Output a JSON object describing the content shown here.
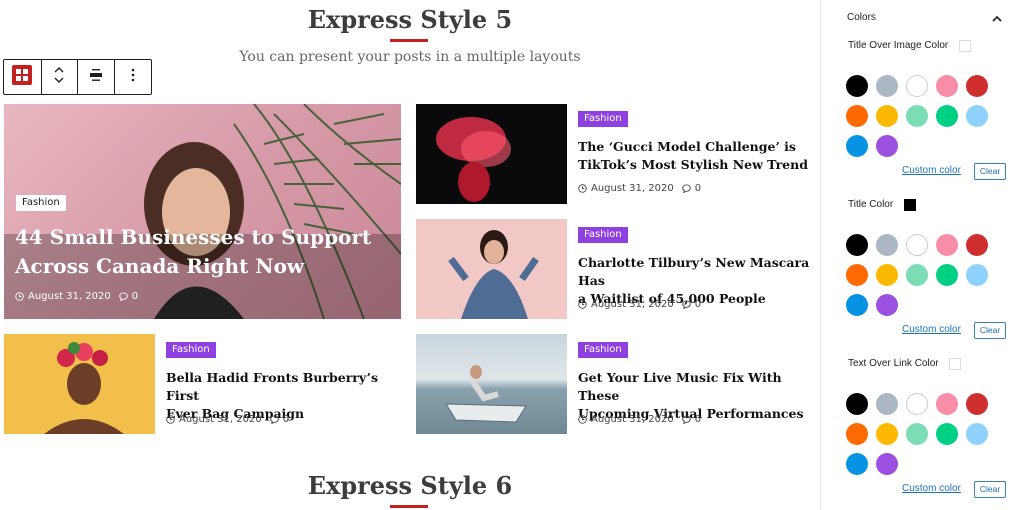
{
  "sections": {
    "style5_title": "Express Style 5",
    "style5_subtitle": "You can present your posts in a multiple layouts",
    "style6_title": "Express Style 6"
  },
  "toolbar": {
    "icons": [
      "block-layout-icon",
      "move-arrows-icon",
      "align-icon",
      "more-options-icon"
    ]
  },
  "featured_post": {
    "category": "Fashion",
    "title_line1": "44 Small Businesses to Support",
    "title_line2": "Across Canada Right Now",
    "date": "August 31, 2020",
    "comments": "0"
  },
  "posts": [
    {
      "category": "Fashion",
      "title_line1": "The ‘Gucci Model Challenge’ is",
      "title_line2": "TikTok’s Most Stylish New Trend",
      "date": "August 31, 2020",
      "comments": "0"
    },
    {
      "category": "Fashion",
      "title_line1": "Charlotte Tilbury’s New Mascara Has",
      "title_line2": "a Waitlist of 45,000 People",
      "date": "August 31, 2020",
      "comments": "0"
    },
    {
      "category": "Fashion",
      "title_line1": "Bella Hadid Fronts Burberry’s First",
      "title_line2": "Ever Bag Campaign",
      "date": "August 31, 2020",
      "comments": "0"
    },
    {
      "category": "Fashion",
      "title_line1": "Get Your Live Music Fix With These",
      "title_line2": "Upcoming Virtual Performances",
      "date": "August 31, 2020",
      "comments": "0"
    }
  ],
  "sidebar": {
    "panel_title": "Colors",
    "options": [
      {
        "label": "Title Over Image Color",
        "selected_color": "#ffffff",
        "custom_label": "Custom color",
        "clear_label": "Clear"
      },
      {
        "label": "Title Color",
        "selected_color": "#000000",
        "custom_label": "Custom color",
        "clear_label": "Clear"
      },
      {
        "label": "Text Over Link Color",
        "selected_color": "#ffffff",
        "custom_label": "Custom color",
        "clear_label": "Clear"
      }
    ],
    "palette": [
      "#000000",
      "#abb8c3",
      "#ffffff",
      "#f78da7",
      "#cf2e2e",
      "#ff6900",
      "#fcb900",
      "#7bdcb5",
      "#00d084",
      "#8ed1fc",
      "#0693e3",
      "#9b51e0"
    ]
  },
  "colors": {
    "accent_red": "#c3201f",
    "badge_purple": "#8f40e0",
    "link_blue": "#1f74b8"
  }
}
